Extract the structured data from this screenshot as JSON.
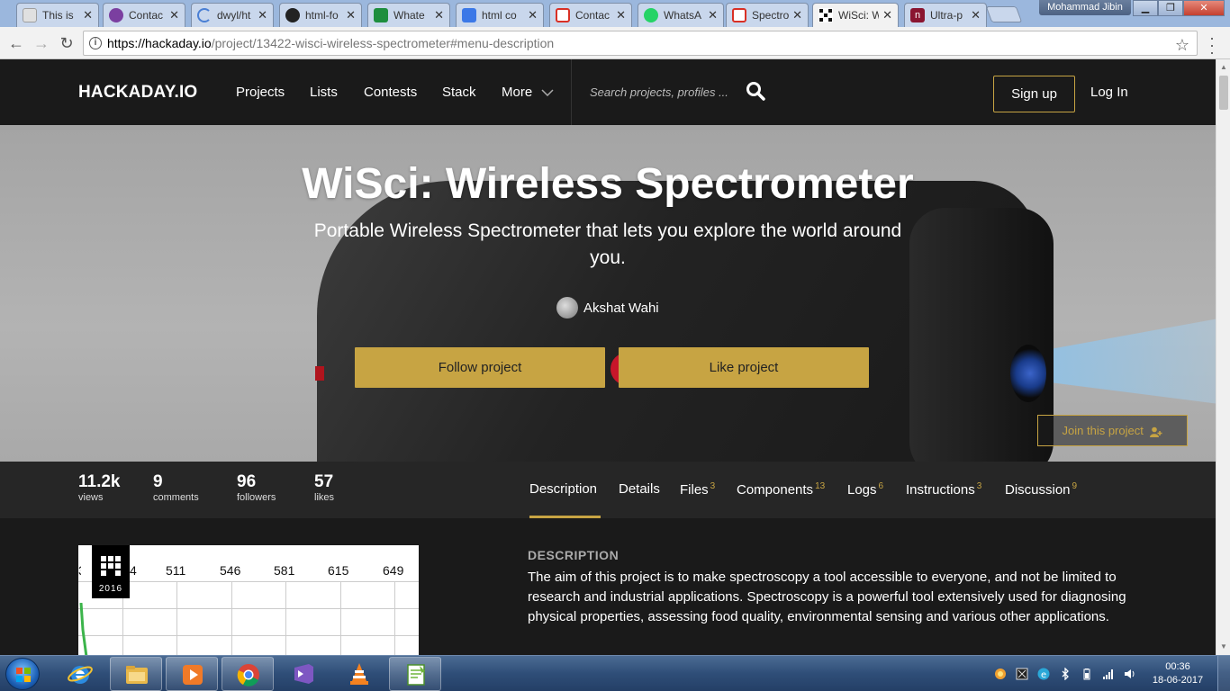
{
  "browser": {
    "tabs": [
      {
        "title": "This is",
        "icon": "page-icon",
        "color": "#9e9e9e"
      },
      {
        "title": "Contac",
        "icon": "contact-icon",
        "color": "#7b3fa0"
      },
      {
        "title": "dwyl/ht",
        "icon": "loading-icon",
        "color": "#4a7fd4"
      },
      {
        "title": "html-fo",
        "icon": "github-icon",
        "color": "#222222"
      },
      {
        "title": "Whate",
        "icon": "sheets-icon",
        "color": "#1e8e3e"
      },
      {
        "title": "html co",
        "icon": "arrow-icon",
        "color": "#3b78e7"
      },
      {
        "title": "Contac",
        "icon": "gmail-icon",
        "color": "#d93025"
      },
      {
        "title": "WhatsA",
        "icon": "whatsapp-icon",
        "color": "#25d366"
      },
      {
        "title": "Spectro",
        "icon": "gmail-icon",
        "color": "#d93025"
      },
      {
        "title": "WiSci: W",
        "icon": "hackaday-icon",
        "color": "#111111"
      },
      {
        "title": "Ultra-p",
        "icon": "n-icon",
        "color": "#8a1530"
      }
    ],
    "active_tab": 9,
    "user": "Mohammad Jibin",
    "url_host": "https://hackaday.io",
    "url_path": "/project/13422-wisci-wireless-spectrometer#menu-description"
  },
  "site": {
    "logo": "HACKADAY.IO",
    "nav": [
      "Projects",
      "Lists",
      "Contests",
      "Stack",
      "More"
    ],
    "search_placeholder": "Search projects, profiles ...",
    "signup": "Sign up",
    "login": "Log In"
  },
  "hero": {
    "title": "WiSci: Wireless Spectrometer",
    "subtitle": "Portable Wireless Spectrometer that lets you explore the world around you.",
    "author": "Akshat Wahi",
    "follow": "Follow project",
    "like": "Like project",
    "join": "Join this project"
  },
  "stats": [
    {
      "num": "11.2k",
      "label": "views"
    },
    {
      "num": "9",
      "label": "comments"
    },
    {
      "num": "96",
      "label": "followers"
    },
    {
      "num": "57",
      "label": "likes"
    }
  ],
  "project_tabs": [
    {
      "label": "Description",
      "count": ""
    },
    {
      "label": "Details",
      "count": ""
    },
    {
      "label": "Files",
      "count": "3"
    },
    {
      "label": "Components",
      "count": "13"
    },
    {
      "label": "Logs",
      "count": "6"
    },
    {
      "label": "Instructions",
      "count": "3"
    },
    {
      "label": "Discussion",
      "count": "9"
    }
  ],
  "chart_ticks": [
    "3",
    "4",
    "511",
    "546",
    "581",
    "615",
    "649"
  ],
  "badge_year": "2016",
  "description": {
    "heading": "DESCRIPTION",
    "body": "The aim of this project is to make spectroscopy a tool accessible to everyone, and not be limited to research and industrial applications. Spectroscopy is a powerful tool extensively used for diagnosing physical properties, assessing food quality, environmental sensing and various other applications."
  },
  "taskbar": {
    "time": "00:36",
    "date": "18-06-2017"
  },
  "colors": {
    "accent": "#c7a443",
    "nav_bg": "#1a1a1a",
    "stats_bg": "#262626"
  }
}
